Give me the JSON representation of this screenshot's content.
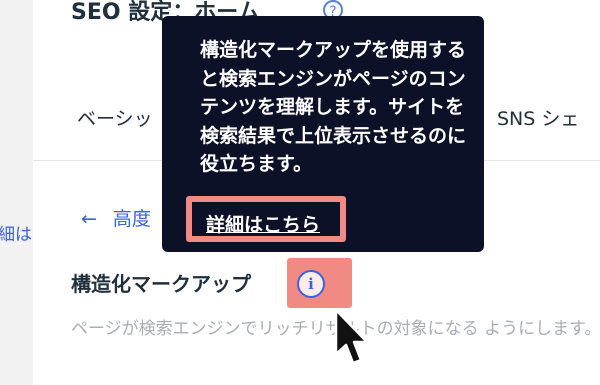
{
  "page": {
    "title": "SEO 設定：ホーム",
    "help_icon": "?"
  },
  "left_panel": {
    "partial_link": "細は"
  },
  "tabs": [
    {
      "label": "ベーシッ"
    },
    {
      "label": "SNS シェ"
    }
  ],
  "back_link": {
    "arrow": "←",
    "label": "高度"
  },
  "section": {
    "title": "構造化マークアップ",
    "description": "ページが検索エンジンでリッチリザルトの対象になる ようにします。"
  },
  "tooltip": {
    "text": "構造化マークアップを使用すると検索エンジンがページのコンテンツを理解します。サイトを検索結果で上位表示させるのに役立ちます。",
    "link_label": "詳細はこちら"
  },
  "icons": {
    "info": "info-icon",
    "cursor": "mouse-pointer-icon"
  },
  "colors": {
    "accent": "#3b62e0",
    "highlight": "#f08a82",
    "tooltip_bg": "#0d1127"
  }
}
